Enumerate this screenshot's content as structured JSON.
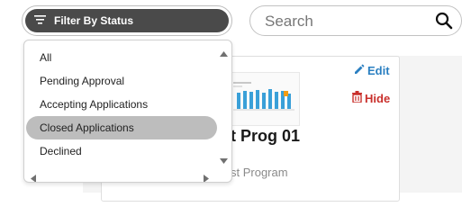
{
  "filter": {
    "label": "Filter By Status"
  },
  "search": {
    "placeholder": "Search"
  },
  "status_menu": {
    "items": [
      {
        "label": "All"
      },
      {
        "label": "Pending Approval"
      },
      {
        "label": "Accepting Applications"
      },
      {
        "label": "Closed Applications"
      },
      {
        "label": "Declined"
      }
    ],
    "selected": "Closed Applications"
  },
  "card": {
    "title": "t Prog 01",
    "subtitle": "st Program",
    "edit_label": "Edit",
    "hide_label": "Hide"
  },
  "colors": {
    "filter_bg": "#4a4a4a",
    "selected_bg": "#bdbdbd",
    "edit": "#2a7fc1",
    "hide": "#c9302c",
    "chart_bars": "#3aa0d8"
  }
}
